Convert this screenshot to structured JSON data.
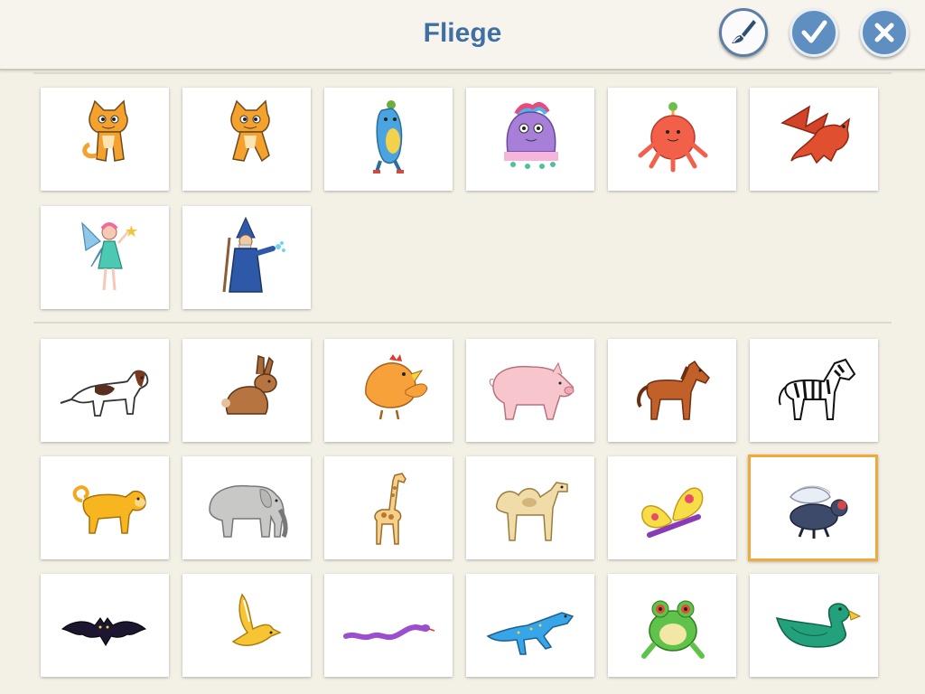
{
  "header": {
    "title": "Fliege",
    "buttons": [
      {
        "name": "paint-editor-button",
        "icon": "paintbrush-icon"
      },
      {
        "name": "confirm-button",
        "icon": "checkmark-icon"
      },
      {
        "name": "cancel-button",
        "icon": "close-icon"
      }
    ]
  },
  "sections": {
    "characters": [
      "cat",
      "cat-walking",
      "blue-creature",
      "purple-monster",
      "red-octopus",
      "dragon",
      "fairy",
      "wizard"
    ],
    "animals": [
      "dog",
      "rabbit",
      "chicken",
      "pig",
      "horse",
      "zebra",
      "monkey",
      "elephant",
      "giraffe",
      "camel",
      "butterfly",
      "fly",
      "bat",
      "bird",
      "snake",
      "lizard",
      "frog",
      "duck"
    ]
  },
  "selected": "fly",
  "colors": {
    "accent": "#3f6fa3",
    "selection": "#f2a93b",
    "button": "#5f8fc0"
  }
}
